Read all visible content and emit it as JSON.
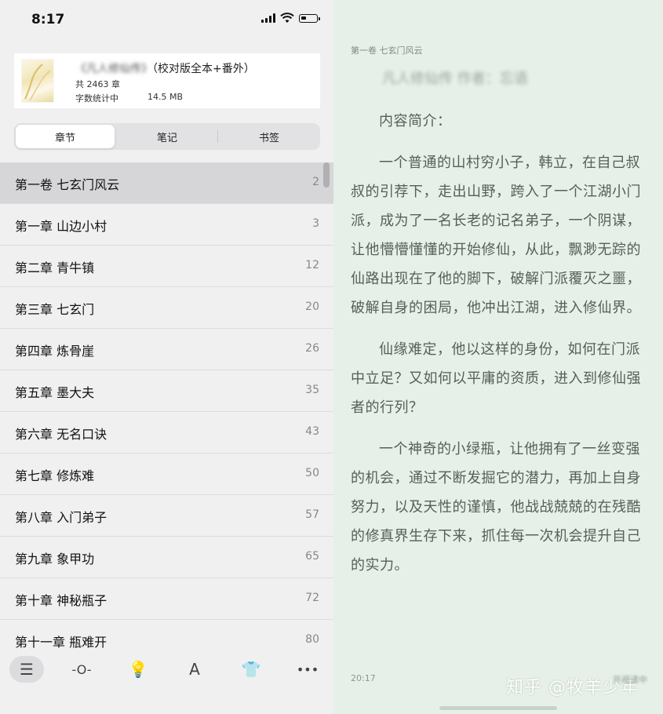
{
  "status_bar": {
    "time": "8:17",
    "battery_level": 0.35
  },
  "book": {
    "title_blurred": "《凡人修仙传》",
    "title_suffix": "（校对版全本+番外）",
    "chapter_count": "共 2463 章",
    "word_count_label": "字数统计中",
    "file_size": "14.5 MB"
  },
  "tabs": [
    {
      "label": "章节",
      "active": true
    },
    {
      "label": "笔记",
      "active": false
    },
    {
      "label": "书签",
      "active": false
    }
  ],
  "toc": [
    {
      "title": "第一卷 七玄门风云",
      "page": "2",
      "current": true
    },
    {
      "title": "第一章 山边小村",
      "page": "3"
    },
    {
      "title": "第二章 青牛镇",
      "page": "12"
    },
    {
      "title": "第三章 七玄门",
      "page": "20"
    },
    {
      "title": "第四章 炼骨崖",
      "page": "26"
    },
    {
      "title": "第五章 墨大夫",
      "page": "35"
    },
    {
      "title": "第六章 无名口诀",
      "page": "43"
    },
    {
      "title": "第七章 修炼难",
      "page": "50"
    },
    {
      "title": "第八章 入门弟子",
      "page": "57"
    },
    {
      "title": "第九章 象甲功",
      "page": "65"
    },
    {
      "title": "第十章 神秘瓶子",
      "page": "72"
    },
    {
      "title": "第十一章 瓶难开",
      "page": "80"
    }
  ],
  "toolbar": [
    {
      "icon": "list-icon",
      "glyph": "☰",
      "active": true
    },
    {
      "icon": "progress-icon",
      "glyph": "-O-",
      "active": false
    },
    {
      "icon": "lightbulb-icon",
      "glyph": "💡",
      "active": false
    },
    {
      "icon": "font-icon",
      "glyph": "A",
      "active": false
    },
    {
      "icon": "shirt-icon",
      "glyph": "👕",
      "active": false
    },
    {
      "icon": "more-icon",
      "glyph": "•••",
      "active": false
    }
  ],
  "reader": {
    "header": "第一卷 七玄门风云",
    "blurred_line": "凡人修仙传 作者：忘语",
    "paragraphs": [
      "内容简介：",
      "一个普通的山村穷小子，韩立，在自己叔叔的引荐下，走出山野，跨入了一个江湖小门派，成为了一名长老的记名弟子，一个阴谋，让他懵懵懂懂的开始修仙，从此，飘渺无踪的仙路出现在了他的脚下，破解门派覆灭之噩，破解自身的困局，他冲出江湖，进入修仙界。",
      "仙缘难定，他以这样的身份，如何在门派中立足？又如何以平庸的资质，进入到修仙强者的行列？",
      "一个神奇的小绿瓶，让他拥有了一丝变强的机会，通过不断发掘它的潜力，再加上自身努力，以及天性的谨慎，他战战兢兢的在残酷的修真界生存下来，抓住每一次机会提升自己的实力。"
    ],
    "time": "20:17",
    "watermark": "知乎 @牧羊少年",
    "progress_blurred": "开阅读中"
  }
}
